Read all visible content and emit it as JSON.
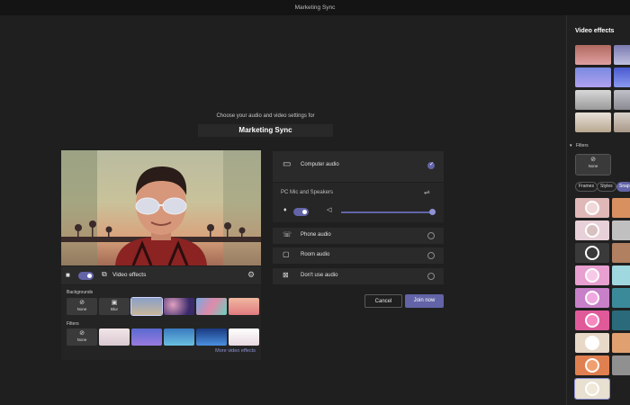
{
  "window": {
    "title": "Marketing Sync"
  },
  "prejoin": {
    "prompt": "Choose your audio and video settings for",
    "meeting_name": "Marketing Sync"
  },
  "video_toolbar": {
    "camera_on": true,
    "effects_label": "Video effects"
  },
  "effects_panel": {
    "backgrounds_label": "Backgrounds",
    "none_label": "None",
    "blur_label": "Blur",
    "filters_label": "Filters",
    "filter_none_label": "None",
    "more_link": "More video effects"
  },
  "audio": {
    "computer_audio": "Computer audio",
    "device": "PC Mic and Speakers",
    "mic_on": true,
    "speaker_volume_pct": 95,
    "phone_audio": "Phone audio",
    "room_audio": "Room audio",
    "dont_use_audio": "Don't use audio",
    "selected": "Computer audio"
  },
  "actions": {
    "cancel": "Cancel",
    "join": "Join now"
  },
  "sidebar": {
    "title": "Video effects",
    "filters_label": "Filters",
    "none_label": "None",
    "tabs": [
      "Frames",
      "Styles",
      "Snap"
    ]
  },
  "colors": {
    "accent": "#6264a7",
    "background": "#1f1f1f",
    "panel": "#2a2a2a"
  }
}
